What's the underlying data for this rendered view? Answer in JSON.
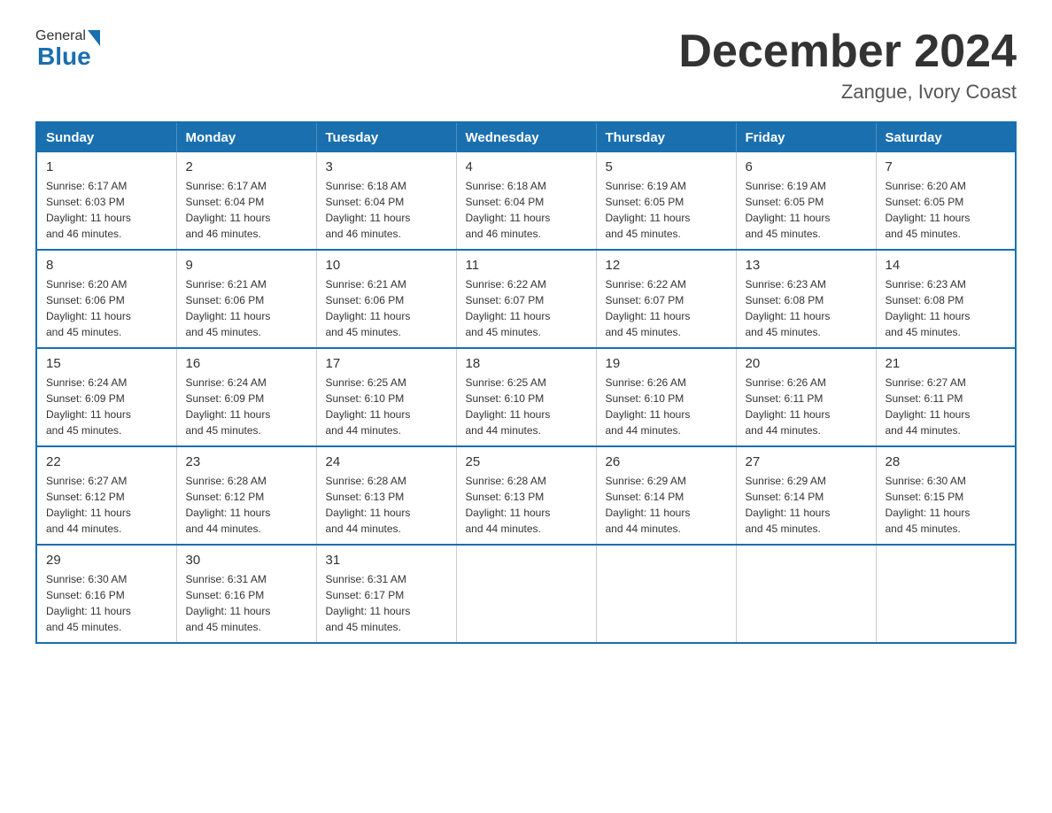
{
  "logo": {
    "general": "General",
    "blue": "Blue"
  },
  "title": "December 2024",
  "location": "Zangue, Ivory Coast",
  "days_of_week": [
    "Sunday",
    "Monday",
    "Tuesday",
    "Wednesday",
    "Thursday",
    "Friday",
    "Saturday"
  ],
  "weeks": [
    [
      {
        "day": "1",
        "sunrise": "6:17 AM",
        "sunset": "6:03 PM",
        "daylight": "11 hours and 46 minutes."
      },
      {
        "day": "2",
        "sunrise": "6:17 AM",
        "sunset": "6:04 PM",
        "daylight": "11 hours and 46 minutes."
      },
      {
        "day": "3",
        "sunrise": "6:18 AM",
        "sunset": "6:04 PM",
        "daylight": "11 hours and 46 minutes."
      },
      {
        "day": "4",
        "sunrise": "6:18 AM",
        "sunset": "6:04 PM",
        "daylight": "11 hours and 46 minutes."
      },
      {
        "day": "5",
        "sunrise": "6:19 AM",
        "sunset": "6:05 PM",
        "daylight": "11 hours and 45 minutes."
      },
      {
        "day": "6",
        "sunrise": "6:19 AM",
        "sunset": "6:05 PM",
        "daylight": "11 hours and 45 minutes."
      },
      {
        "day": "7",
        "sunrise": "6:20 AM",
        "sunset": "6:05 PM",
        "daylight": "11 hours and 45 minutes."
      }
    ],
    [
      {
        "day": "8",
        "sunrise": "6:20 AM",
        "sunset": "6:06 PM",
        "daylight": "11 hours and 45 minutes."
      },
      {
        "day": "9",
        "sunrise": "6:21 AM",
        "sunset": "6:06 PM",
        "daylight": "11 hours and 45 minutes."
      },
      {
        "day": "10",
        "sunrise": "6:21 AM",
        "sunset": "6:06 PM",
        "daylight": "11 hours and 45 minutes."
      },
      {
        "day": "11",
        "sunrise": "6:22 AM",
        "sunset": "6:07 PM",
        "daylight": "11 hours and 45 minutes."
      },
      {
        "day": "12",
        "sunrise": "6:22 AM",
        "sunset": "6:07 PM",
        "daylight": "11 hours and 45 minutes."
      },
      {
        "day": "13",
        "sunrise": "6:23 AM",
        "sunset": "6:08 PM",
        "daylight": "11 hours and 45 minutes."
      },
      {
        "day": "14",
        "sunrise": "6:23 AM",
        "sunset": "6:08 PM",
        "daylight": "11 hours and 45 minutes."
      }
    ],
    [
      {
        "day": "15",
        "sunrise": "6:24 AM",
        "sunset": "6:09 PM",
        "daylight": "11 hours and 45 minutes."
      },
      {
        "day": "16",
        "sunrise": "6:24 AM",
        "sunset": "6:09 PM",
        "daylight": "11 hours and 45 minutes."
      },
      {
        "day": "17",
        "sunrise": "6:25 AM",
        "sunset": "6:10 PM",
        "daylight": "11 hours and 44 minutes."
      },
      {
        "day": "18",
        "sunrise": "6:25 AM",
        "sunset": "6:10 PM",
        "daylight": "11 hours and 44 minutes."
      },
      {
        "day": "19",
        "sunrise": "6:26 AM",
        "sunset": "6:10 PM",
        "daylight": "11 hours and 44 minutes."
      },
      {
        "day": "20",
        "sunrise": "6:26 AM",
        "sunset": "6:11 PM",
        "daylight": "11 hours and 44 minutes."
      },
      {
        "day": "21",
        "sunrise": "6:27 AM",
        "sunset": "6:11 PM",
        "daylight": "11 hours and 44 minutes."
      }
    ],
    [
      {
        "day": "22",
        "sunrise": "6:27 AM",
        "sunset": "6:12 PM",
        "daylight": "11 hours and 44 minutes."
      },
      {
        "day": "23",
        "sunrise": "6:28 AM",
        "sunset": "6:12 PM",
        "daylight": "11 hours and 44 minutes."
      },
      {
        "day": "24",
        "sunrise": "6:28 AM",
        "sunset": "6:13 PM",
        "daylight": "11 hours and 44 minutes."
      },
      {
        "day": "25",
        "sunrise": "6:28 AM",
        "sunset": "6:13 PM",
        "daylight": "11 hours and 44 minutes."
      },
      {
        "day": "26",
        "sunrise": "6:29 AM",
        "sunset": "6:14 PM",
        "daylight": "11 hours and 44 minutes."
      },
      {
        "day": "27",
        "sunrise": "6:29 AM",
        "sunset": "6:14 PM",
        "daylight": "11 hours and 45 minutes."
      },
      {
        "day": "28",
        "sunrise": "6:30 AM",
        "sunset": "6:15 PM",
        "daylight": "11 hours and 45 minutes."
      }
    ],
    [
      {
        "day": "29",
        "sunrise": "6:30 AM",
        "sunset": "6:16 PM",
        "daylight": "11 hours and 45 minutes."
      },
      {
        "day": "30",
        "sunrise": "6:31 AM",
        "sunset": "6:16 PM",
        "daylight": "11 hours and 45 minutes."
      },
      {
        "day": "31",
        "sunrise": "6:31 AM",
        "sunset": "6:17 PM",
        "daylight": "11 hours and 45 minutes."
      },
      null,
      null,
      null,
      null
    ]
  ],
  "labels": {
    "sunrise": "Sunrise:",
    "sunset": "Sunset:",
    "daylight": "Daylight:"
  }
}
